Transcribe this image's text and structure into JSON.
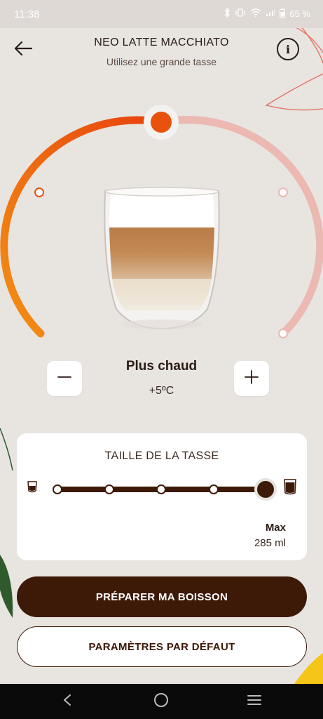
{
  "status_bar": {
    "time": "11:38",
    "battery": "65 %"
  },
  "header": {
    "title": "NEO LATTE MACCHIATO",
    "subtitle": "Utilisez une grande tasse"
  },
  "temperature": {
    "label": "Plus chaud",
    "value": "+5ºC",
    "level_steps": 5,
    "selected_step": 3
  },
  "cup_size": {
    "title": "TAILLE DE LA TASSE",
    "steps": 5,
    "selected_step": 5,
    "selected_label": "Max",
    "selected_volume": "285 ml"
  },
  "buttons": {
    "primary": "PRÉPARER MA BOISSON",
    "secondary": "PARAMÈTRES PAR DÉFAUT"
  },
  "colors": {
    "accent": "#e8520c",
    "arc_light": "#ebb8b2",
    "dark_brown": "#3d1a08",
    "background": "#e8e5e1"
  },
  "icons": {
    "back": "arrow-left-icon",
    "info": "info-icon",
    "minus": "minus-icon",
    "plus": "plus-icon",
    "nav_back": "nav-back-icon",
    "nav_home": "nav-home-icon",
    "nav_recents": "nav-recents-icon"
  }
}
